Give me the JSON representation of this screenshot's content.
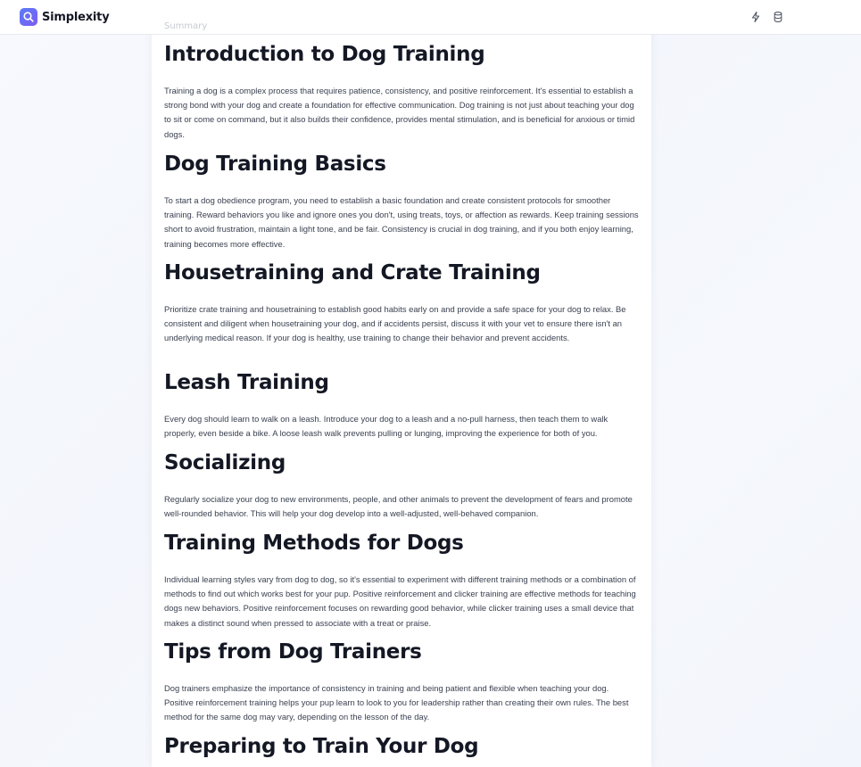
{
  "header": {
    "brand": "Simplexity",
    "icons": [
      "search-icon",
      "bolt-icon",
      "database-icon"
    ]
  },
  "faded_label": "Summary",
  "sections": [
    {
      "heading": "Introduction to Dog Training",
      "body": "Training a dog is a complex process that requires patience, consistency, and positive reinforcement. It's essential to establish a strong bond with your dog and create a foundation for effective communication. Dog training is not just about teaching your dog to sit or come on command, but it also builds their confidence, provides mental stimulation, and is beneficial for anxious or timid dogs."
    },
    {
      "heading": "Dog Training Basics",
      "body": "To start a dog obedience program, you need to establish a basic foundation and create consistent protocols for smoother training. Reward behaviors you like and ignore ones you don't, using treats, toys, or affection as rewards. Keep training sessions short to avoid frustration, maintain a light tone, and be fair. Consistency is crucial in dog training, and if you both enjoy learning, training becomes more effective."
    },
    {
      "heading": "Housetraining and Crate Training",
      "body": "Prioritize crate training and housetraining to establish good habits early on and provide a safe space for your dog to relax. Be consistent and diligent when housetraining your dog, and if accidents persist, discuss it with your vet to ensure there isn't an underlying medical reason. If your dog is healthy, use training to change their behavior and prevent accidents."
    },
    {
      "heading": "Leash Training",
      "body": "Every dog should learn to walk on a leash. Introduce your dog to a leash and a no-pull harness, then teach them to walk properly, even beside a bike. A loose leash walk prevents pulling or lunging, improving the experience for both of you."
    },
    {
      "heading": "Socializing",
      "body": "Regularly socialize your dog to new environments, people, and other animals to prevent the development of fears and promote well-rounded behavior. This will help your dog develop into a well-adjusted, well-behaved companion."
    },
    {
      "heading": "Training Methods for Dogs",
      "body": "Individual learning styles vary from dog to dog, so it's essential to experiment with different training methods or a combination of methods to find out which works best for your pup. Positive reinforcement and clicker training are effective methods for teaching dogs new behaviors. Positive reinforcement focuses on rewarding good behavior, while clicker training uses a small device that makes a distinct sound when pressed to associate with a treat or praise."
    },
    {
      "heading": "Tips from Dog Trainers",
      "body": "Dog trainers emphasize the importance of consistency in training and being patient and flexible when teaching your dog. Positive reinforcement training helps your pup learn to look to you for leadership rather than creating their own rules. The best method for the same dog may vary, depending on the lesson of the day."
    },
    {
      "heading": "Preparing to Train Your Dog",
      "body": ""
    }
  ]
}
